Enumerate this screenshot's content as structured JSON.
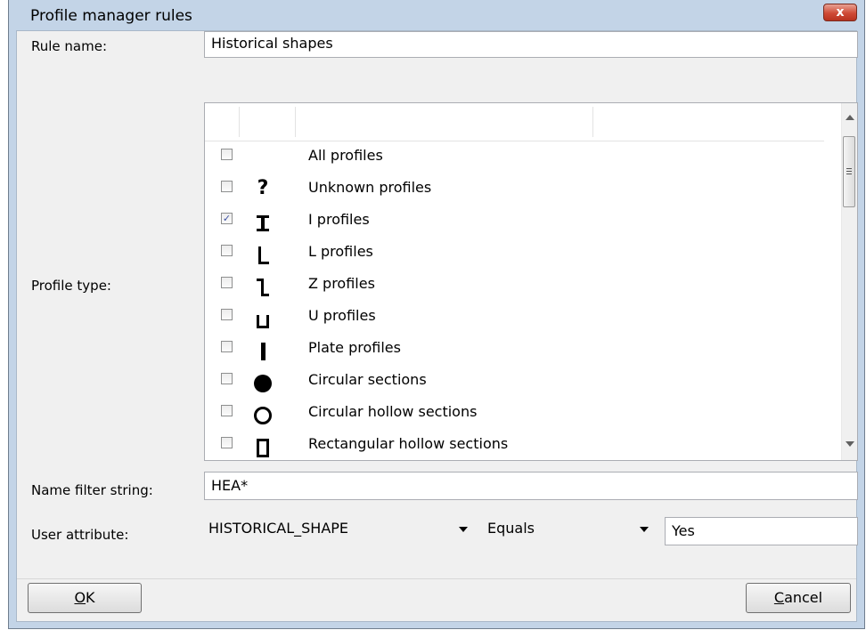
{
  "window": {
    "title": "Profile manager rules",
    "close_glyph": "x"
  },
  "rule_name": {
    "label": "Rule name:",
    "value": "Historical shapes"
  },
  "profile_type": {
    "label": "Profile type:",
    "items": [
      {
        "label": "All profiles",
        "checked": false,
        "icon": "none"
      },
      {
        "label": "Unknown profiles",
        "checked": false,
        "icon": "question-mark-icon",
        "glyph": "?"
      },
      {
        "label": "I profiles",
        "checked": true,
        "icon": "i-beam-icon"
      },
      {
        "label": "L profiles",
        "checked": false,
        "icon": "l-shape-icon"
      },
      {
        "label": "Z profiles",
        "checked": false,
        "icon": "z-shape-icon"
      },
      {
        "label": "U profiles",
        "checked": false,
        "icon": "u-shape-icon"
      },
      {
        "label": "Plate profiles",
        "checked": false,
        "icon": "plate-bar-icon"
      },
      {
        "label": "Circular sections",
        "checked": false,
        "icon": "filled-circle-icon"
      },
      {
        "label": "Circular hollow sections",
        "checked": false,
        "icon": "hollow-circle-icon"
      },
      {
        "label": "Rectangular hollow sections",
        "checked": false,
        "icon": "hollow-rectangle-icon"
      }
    ]
  },
  "name_filter": {
    "label": "Name filter string:",
    "value": "HEA*"
  },
  "user_attribute": {
    "label": "User attribute:",
    "attribute": "HISTORICAL_SHAPE",
    "operator": "Equals",
    "value": "Yes"
  },
  "buttons": {
    "ok_mnemonic": "O",
    "ok_rest": "K",
    "cancel_mnemonic": "C",
    "cancel_rest": "ancel"
  },
  "check_glyph": "✓"
}
